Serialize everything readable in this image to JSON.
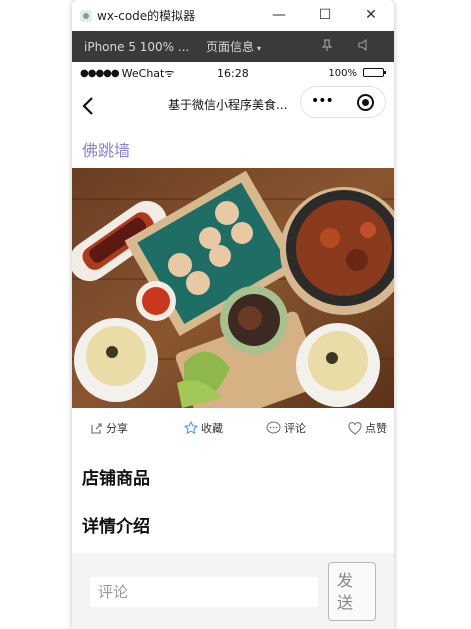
{
  "window": {
    "title": "wx-code的模拟器",
    "minimize": "—",
    "maximize": "☐",
    "close": "✕"
  },
  "toolbar": {
    "device": "iPhone 5 100% ...",
    "page_info": "页面信息",
    "caret": "▾",
    "pin_icon": "pin-icon",
    "mute_icon": "speaker-icon"
  },
  "status": {
    "dots": "●●●●●",
    "carrier": "WeChat",
    "wifi": "ᯤ",
    "time": "16:28",
    "battery": "100%"
  },
  "navbar": {
    "title": "基于微信小程序美食...",
    "menu": "•••"
  },
  "shop": {
    "name": "佛跳墙"
  },
  "actions": [
    {
      "label": "分享",
      "icon": "share-icon"
    },
    {
      "label": "收藏",
      "icon": "star-icon"
    },
    {
      "label": "评论",
      "icon": "comment-icon"
    },
    {
      "label": "点赞",
      "icon": "heart-icon"
    }
  ],
  "sections": {
    "products": "店铺商品",
    "details": "详情介绍"
  },
  "comment": {
    "placeholder": "评论",
    "send_line1": "发",
    "send_line2": "送"
  },
  "colors": {
    "accent": "#8b83d6",
    "star": "#4aa0e0",
    "toolbar": "#3a3a3a"
  }
}
